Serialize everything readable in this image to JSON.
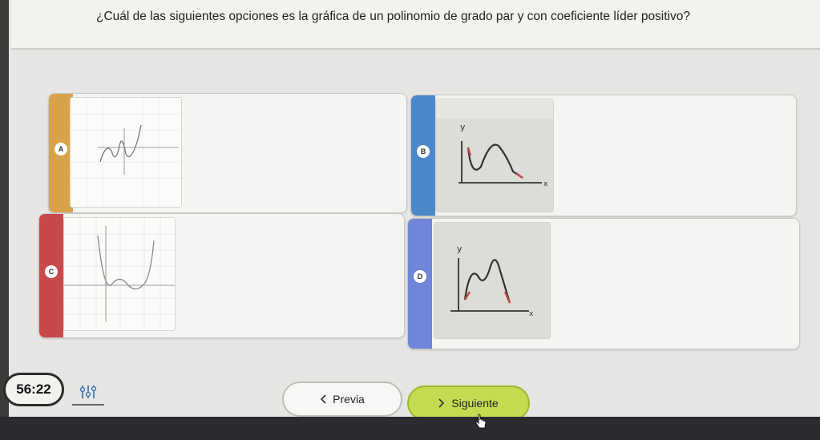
{
  "question": {
    "text": "¿Cuál de las siguientes opciones es la gráfica de un polinomio de grado par y con coeficiente líder positivo?"
  },
  "options": [
    {
      "letter": "A",
      "strip_color": "#d9a24a"
    },
    {
      "letter": "B",
      "strip_color": "#4a88c9"
    },
    {
      "letter": "C",
      "strip_color": "#c9484a"
    },
    {
      "letter": "D",
      "strip_color": "#6f86d9"
    }
  ],
  "graph_labels": {
    "b_y": "y",
    "b_x": "x",
    "d_y": "y",
    "d_x": "x"
  },
  "timer": {
    "text": "56:22"
  },
  "footer": {
    "prev_label": "Previa",
    "next_label": "Siguiente",
    "prev_icon": "chevron-left-icon",
    "next_icon": "chevron-right-icon",
    "tools_icon": "sliders-icon"
  }
}
